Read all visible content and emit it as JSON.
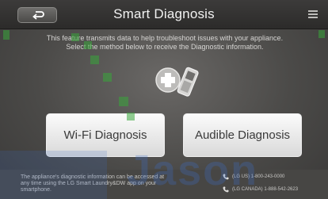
{
  "header": {
    "title": "Smart Diagnosis",
    "back_icon": "back-arrow-icon",
    "menu_icon": "menu-icon"
  },
  "description": {
    "line1": "This feature transmits data to help troubleshoot issues with your appliance.",
    "line2": "Select the method below to receive the Diagnostic information."
  },
  "illustration": {
    "icon": "device-medical-cross-icon"
  },
  "buttons": {
    "wifi_label": "Wi-Fi Diagnosis",
    "audible_label": "Audible Diagnosis"
  },
  "footer": {
    "note_line1": "The appliance's diagnostic information can be accessed at",
    "note_line2": "any time using the LG Smart Laundry&DW app on your",
    "note_line3": "smartphone.",
    "support_us": "(LG US) 1-800-243-0000",
    "support_ca": "(LG CANADA) 1-888-542-2623",
    "phone_icon": "phone-icon"
  },
  "watermark": {
    "text": "Jason"
  },
  "colors": {
    "header_bg": "#2c2b2a",
    "screen_bg": "#4b4a48",
    "button_bg": "#f2f2f2",
    "button_text": "#3a3a3a",
    "footer_bg": "#474644",
    "overlay_green": "#39a53a",
    "watermark_blue": "#3c6ec8"
  }
}
